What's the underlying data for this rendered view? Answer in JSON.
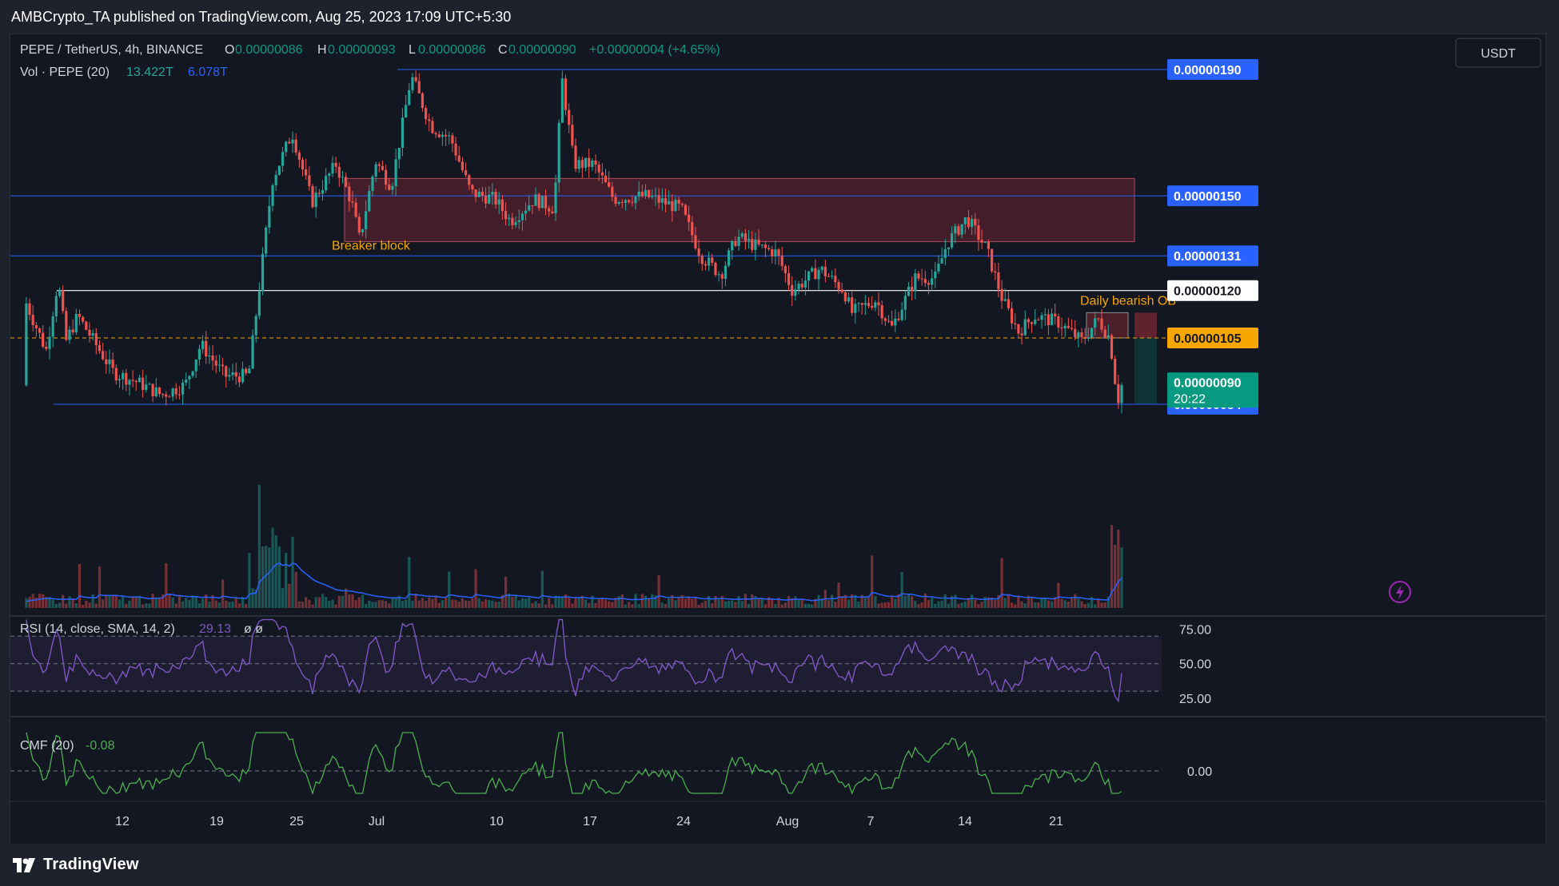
{
  "header": {
    "publish_line": "AMBCrypto_TA published on TradingView.com, Aug 25, 2023 17:09 UTC+5:30"
  },
  "footer": {
    "brand": "TradingView"
  },
  "chart_data": {
    "type": "candlestick",
    "symbol": "PEPE / TetherUS, 4h, BINANCE",
    "ohlc_legend": {
      "o_label": "O",
      "o": "0.00000086",
      "h_label": "H",
      "h": "0.00000093",
      "l_label": "L",
      "l": "0.00000086",
      "c_label": "C",
      "c": "0.00000090",
      "change": "+0.00000004 (+4.65%)"
    },
    "volume_legend": {
      "label": "Vol · PEPE (20)",
      "value": "13.422T",
      "ma": "6.078T"
    },
    "currency_button": "USDT",
    "price_axis": {
      "min": 7e-07,
      "max": 1.96e-06
    },
    "x_axis_ticks": [
      "12",
      "19",
      "25",
      "Jul",
      "10",
      "17",
      "24",
      "Aug",
      "7",
      "14",
      "21"
    ],
    "price_series": {
      "description": "approximate close path read off candles",
      "points": [
        [
          1.28e-06,
          1.28e-06
        ],
        [
          0.02,
          1.16e-06
        ],
        [
          0.045,
          1.01e-06
        ],
        [
          0.06,
          1.23e-06
        ],
        [
          0.07,
          1.04e-06
        ],
        [
          0.085,
          1.12e-06
        ],
        [
          0.1,
          1.06e-06
        ],
        [
          0.13,
          9.4e-07
        ],
        [
          0.16,
          9.1e-07
        ],
        [
          0.19,
          8.7e-07
        ],
        [
          0.22,
          9e-07
        ],
        [
          0.24,
          1.03e-06
        ],
        [
          0.27,
          9.3e-07
        ],
        [
          0.3,
          9.3e-07
        ],
        [
          0.315,
          1.24e-06
        ],
        [
          0.33,
          1.55e-06
        ],
        [
          0.355,
          1.7e-06
        ],
        [
          0.38,
          1.48e-06
        ],
        [
          0.41,
          1.6e-06
        ],
        [
          0.43,
          1.48e-06
        ],
        [
          0.44,
          1.36e-06
        ],
        [
          0.46,
          1.61e-06
        ],
        [
          0.48,
          1.53e-06
        ],
        [
          0.505,
          1.88e-06
        ],
        [
          0.53,
          1.72e-06
        ],
        [
          0.555,
          1.68e-06
        ],
        [
          0.58,
          1.51e-06
        ],
        [
          0.61,
          1.49e-06
        ],
        [
          0.63,
          1.42e-06
        ],
        [
          0.66,
          1.49e-06
        ],
        [
          0.685,
          1.46e-06
        ],
        [
          0.695,
          1.87e-06
        ],
        [
          0.71,
          1.6e-06
        ],
        [
          0.735,
          1.6e-06
        ],
        [
          0.76,
          1.49e-06
        ],
        [
          0.8,
          1.5e-06
        ],
        [
          0.845,
          1.46e-06
        ],
        [
          0.87,
          1.31e-06
        ],
        [
          0.895,
          1.25e-06
        ],
        [
          0.915,
          1.37e-06
        ],
        [
          0.94,
          1.34e-06
        ],
        [
          0.965,
          1.32e-06
        ],
        [
          0.985,
          1.2e-06
        ],
        [
          1.02,
          1.27e-06
        ],
        [
          1.05,
          1.2e-06
        ],
        [
          1.06,
          1.13e-06
        ],
        [
          1.09,
          1.17e-06
        ],
        [
          1.11,
          1.08e-06
        ],
        [
          1.14,
          1.24e-06
        ],
        [
          1.165,
          1.24e-06
        ],
        [
          1.18,
          1.35e-06
        ],
        [
          1.205,
          1.43e-06
        ],
        [
          1.23,
          1.33e-06
        ],
        [
          1.25,
          1.17e-06
        ],
        [
          1.27,
          1.07e-06
        ],
        [
          1.29,
          1.12e-06
        ],
        [
          1.32,
          1.1e-06
        ],
        [
          1.35,
          1.04e-06
        ],
        [
          1.37,
          1.11e-06
        ],
        [
          1.385,
          1.05e-06
        ],
        [
          1.395,
          8.5e-07
        ],
        [
          1.4,
          9e-07
        ]
      ]
    },
    "horizontal_levels": [
      {
        "price": 1.9e-06,
        "label": "0.00000190",
        "color": "#2962ff"
      },
      {
        "price": 1.5e-06,
        "label": "0.00000150",
        "color": "#2962ff"
      },
      {
        "price": 1.31e-06,
        "label": "0.00000131",
        "color": "#2962ff"
      },
      {
        "price": 1.2e-06,
        "label": "0.00000120",
        "color": "#ffffff"
      },
      {
        "price": 1.05e-06,
        "label": "0.00000105",
        "color": "#f7a600",
        "dashed": true
      },
      {
        "price": 8.4e-07,
        "label": "0.00000084",
        "color": "#2962ff"
      }
    ],
    "current_price_tag": {
      "price": "0.00000090",
      "countdown": "20:22",
      "color": "#089981"
    },
    "zones": [
      {
        "label": "Breaker block",
        "top": 1.55e-06,
        "bottom": 1.36e-06,
        "color": "#f7a600"
      },
      {
        "label": "Daily bearish OB",
        "top": 1.13e-06,
        "bottom": 1.05e-06,
        "color": "#f7a600"
      }
    ],
    "rsi": {
      "legend": "RSI (14, close, SMA, 14, 2)",
      "value": "29.13",
      "extra": "ø  ø",
      "ticks": [
        "75.00",
        "50.00",
        "25.00"
      ],
      "levels": [
        70,
        50,
        30
      ]
    },
    "cmf": {
      "legend": "CMF (20)",
      "value": "-0.08",
      "ticks": [
        "0.00"
      ]
    },
    "colors": {
      "up": "#26a69a",
      "down": "#ef5350",
      "level_blue": "#2962ff",
      "orange": "#f7a600",
      "rsi": "#7e57c2",
      "cmf": "#4caf50",
      "volume_ma": "#2962ff",
      "background": "#131722"
    }
  }
}
